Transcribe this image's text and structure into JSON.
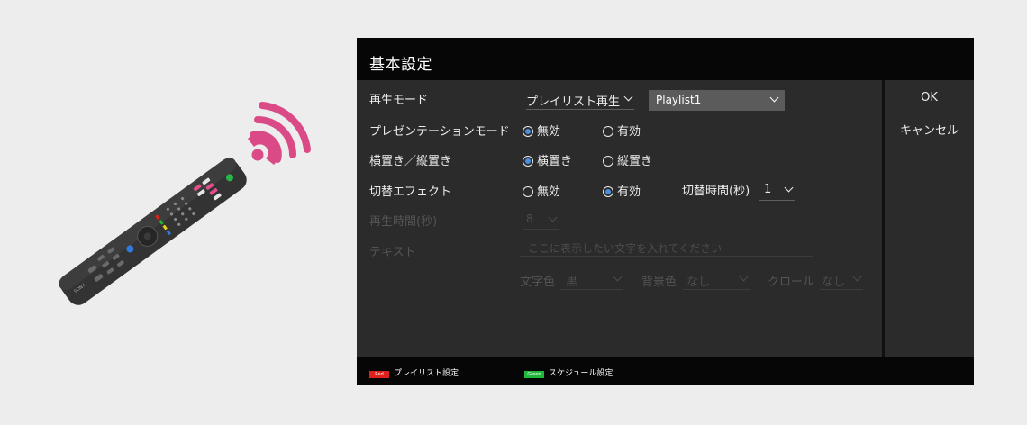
{
  "screen": {
    "title": "基本設定"
  },
  "rows": {
    "playback_mode": {
      "label": "再生モード",
      "mode_value": "プレイリスト再生",
      "playlist_value": "Playlist1"
    },
    "presentation_mode": {
      "label": "プレゼンテーションモード",
      "option_off": "無効",
      "option_on": "有効",
      "selected": "無効"
    },
    "orientation": {
      "label": "横置き／縦置き",
      "option_landscape": "横置き",
      "option_portrait": "縦置き",
      "selected": "横置き"
    },
    "switch_effect": {
      "label": "切替エフェクト",
      "option_off": "無効",
      "option_on": "有効",
      "selected": "有効",
      "switch_time_label": "切替時間(秒)",
      "switch_time_value": "1"
    },
    "playback_time": {
      "label": "再生時間(秒)",
      "value": "8"
    },
    "text": {
      "label": "テキスト",
      "placeholder": "ここに表示したい文字を入れてください",
      "text_color_label": "文字色",
      "text_color_value": "黒",
      "bg_color_label": "背景色",
      "bg_color_value": "なし",
      "crawl_label": "クロール",
      "crawl_value": "なし"
    }
  },
  "side_buttons": {
    "ok": "OK",
    "cancel": "キャンセル"
  },
  "footer": {
    "red_key": "Red",
    "red_label": "プレイリスト設定",
    "green_key": "Green",
    "green_label": "スケジュール設定"
  },
  "colors": {
    "remote_body": "#2b2b2b",
    "signal_waves": "#d94a86",
    "radio_selected": "#4a8fe0",
    "red_key": "#e0201b",
    "green_key": "#1fb83a"
  },
  "icons": {
    "remote": "tv-remote-icon",
    "signal": "wireless-signal-icon"
  }
}
